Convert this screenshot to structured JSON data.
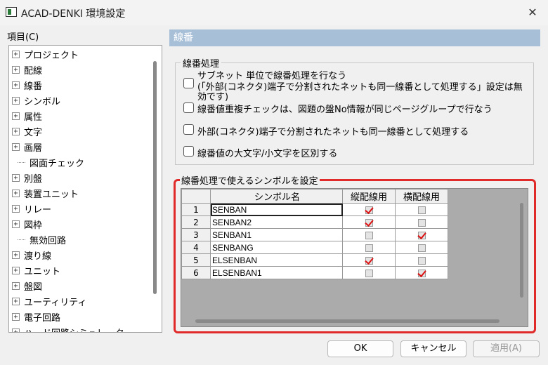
{
  "window": {
    "title": "ACAD-DENKI 環境設定"
  },
  "items_label": "項目(C)",
  "tree": [
    {
      "label": "プロジェクト",
      "expandable": true
    },
    {
      "label": "配線",
      "expandable": true
    },
    {
      "label": "線番",
      "expandable": true
    },
    {
      "label": "シンボル",
      "expandable": true
    },
    {
      "label": "属性",
      "expandable": true
    },
    {
      "label": "文字",
      "expandable": true
    },
    {
      "label": "画層",
      "expandable": true
    },
    {
      "label": "図面チェック",
      "expandable": false
    },
    {
      "label": "別盤",
      "expandable": true
    },
    {
      "label": "装置ユニット",
      "expandable": true
    },
    {
      "label": "リレー",
      "expandable": true
    },
    {
      "label": "図枠",
      "expandable": true
    },
    {
      "label": "無効回路",
      "expandable": false
    },
    {
      "label": "渡り線",
      "expandable": true
    },
    {
      "label": "ユニット",
      "expandable": true
    },
    {
      "label": "盤図",
      "expandable": true
    },
    {
      "label": "ユーティリティ",
      "expandable": true
    },
    {
      "label": "電子回路",
      "expandable": true
    },
    {
      "label": "ハード回路シミュレーター",
      "expandable": true
    }
  ],
  "section_title": "線番",
  "processing_group": {
    "title": "線番処理",
    "options": [
      {
        "line1": "サブネット 単位で線番処理を行なう",
        "line2": "(「外部(コネクタ)端子で分割されたネットも同一線番として処理する」設定は無",
        "line3": "効です)",
        "checked": false
      },
      {
        "line1": "線番値重複チェックは、図題の盤No情報が同じページグループで行なう",
        "checked": false
      },
      {
        "line1": "外部(コネクタ)端子で分割されたネットも同一線番として処理する",
        "checked": false
      },
      {
        "line1": "線番値の大文字/小文字を区別する",
        "checked": false
      }
    ]
  },
  "symbol_group": {
    "title": "線番処理で使えるシンボルを設定",
    "columns": [
      "シンボル名",
      "縦配線用",
      "横配線用"
    ],
    "rows": [
      {
        "no": "1",
        "name": "SENBAN",
        "vertical": true,
        "horizontal": false
      },
      {
        "no": "2",
        "name": "SENBAN2",
        "vertical": true,
        "horizontal": false
      },
      {
        "no": "3",
        "name": "SENBAN1",
        "vertical": false,
        "horizontal": true
      },
      {
        "no": "4",
        "name": "SENBANG",
        "vertical": false,
        "horizontal": false
      },
      {
        "no": "5",
        "name": "ELSENBAN",
        "vertical": true,
        "horizontal": false
      },
      {
        "no": "6",
        "name": "ELSENBAN1",
        "vertical": false,
        "horizontal": true
      }
    ]
  },
  "buttons": {
    "ok": "OK",
    "cancel": "キャンセル",
    "apply": "適用(A)"
  },
  "colors": {
    "section_header": "#a8bfd8",
    "highlight_border": "#e02a2a",
    "check_mark": "#dd1111"
  },
  "icons": {
    "close": "close-icon",
    "app": "app-icon"
  }
}
